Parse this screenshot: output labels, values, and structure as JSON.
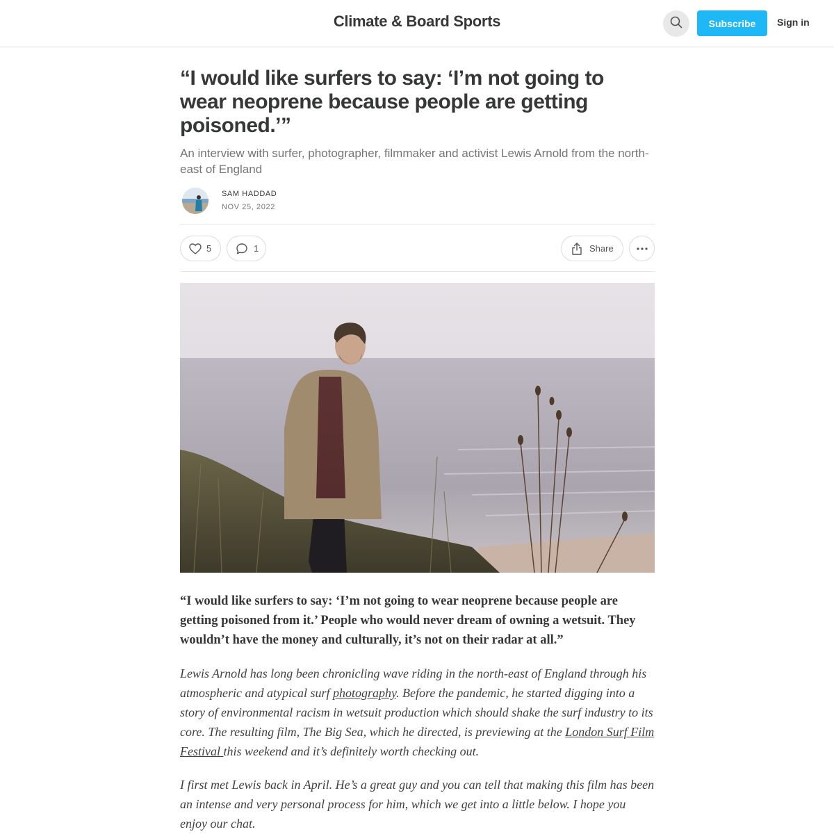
{
  "header": {
    "publication_title": "Climate & Board Sports",
    "subscribe_label": "Subscribe",
    "signin_label": "Sign in",
    "search_icon": "search-icon"
  },
  "post": {
    "title": "“I would like surfers to say: ‘I’m not going to wear neoprene because people are getting poisoned.’”",
    "subtitle": "An interview with surfer, photographer, filmmaker and activist Lewis Arnold from the north-east of England",
    "author": "SAM HADDAD",
    "date": "NOV 25, 2022"
  },
  "actions": {
    "likes": "5",
    "comments": "1",
    "share_label": "Share",
    "icons": [
      "heart-icon",
      "comment-icon",
      "share-icon",
      "more-icon"
    ]
  },
  "body": {
    "quote": "“I would like surfers to say: ‘I’m not going to wear neoprene because people are getting poisoned from it.’ People who would never dream of owning a wetsuit. They wouldn’t have the money and culturally, it’s not on their radar at all.”",
    "p1_a": "Lewis Arnold has long been chronicling wave riding in the north-east of England through his atmospheric and atypical surf ",
    "p1_link1": "photography",
    "p1_b": ". Before the pandemic, he started digging into a story of environmental racism in wetsuit production which should shake the surf industry to its core. The resulting film, The Big Sea, which he directed, is previewing at the ",
    "p1_link2": "London Surf Film Festival ",
    "p1_c": "this weekend and it’s definitely worth checking out.",
    "p2": "I first met Lewis back in April. He’s a great guy and you can tell that making this film has been an intense and very personal process for him, which we get into a little below. I hope you enjoy our chat."
  },
  "colors": {
    "accent": "#1eb8f7",
    "text": "#363737",
    "muted": "#757575"
  }
}
